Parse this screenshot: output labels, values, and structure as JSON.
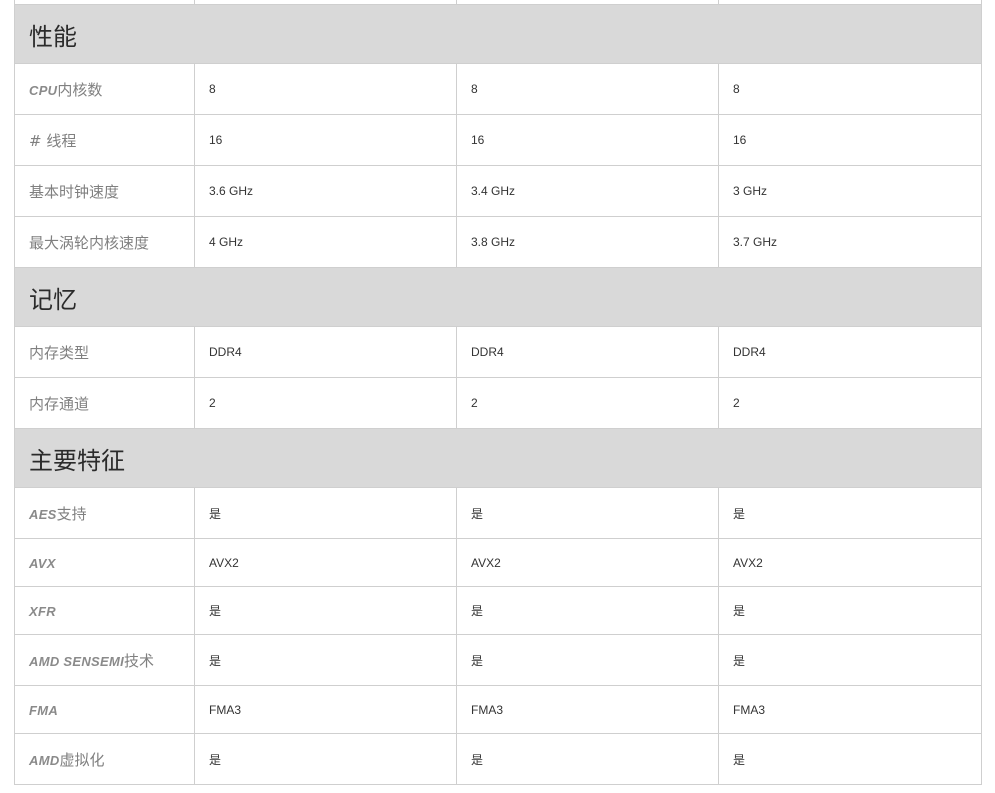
{
  "performance": {
    "title": "性能",
    "rows": [
      {
        "label_latin": "CPU",
        "label": "内核数",
        "values": [
          "8",
          "8",
          "8"
        ]
      },
      {
        "label_latin": "",
        "label": "# 线程",
        "values": [
          "16",
          "16",
          "16"
        ]
      },
      {
        "label_latin": "",
        "label": "基本时钟速度",
        "values": [
          "3.6 GHz",
          "3.4 GHz",
          "3 GHz"
        ]
      },
      {
        "label_latin": "",
        "label": "最大涡轮内核速度",
        "values": [
          "4 GHz",
          "3.8 GHz",
          "3.7 GHz"
        ]
      }
    ]
  },
  "memory": {
    "title": "记忆",
    "rows": [
      {
        "label_latin": "",
        "label": "内存类型",
        "values": [
          "DDR4",
          "DDR4",
          "DDR4"
        ]
      },
      {
        "label_latin": "",
        "label": "内存通道",
        "values": [
          "2",
          "2",
          "2"
        ]
      }
    ]
  },
  "features": {
    "title": "主要特征",
    "rows": [
      {
        "label_latin": "AES",
        "label": "支持",
        "values": [
          "是",
          "是",
          "是"
        ]
      },
      {
        "label_latin": "AVX",
        "label": "",
        "values": [
          "AVX2",
          "AVX2",
          "AVX2"
        ]
      },
      {
        "label_latin": "XFR",
        "label": "",
        "values": [
          "是",
          "是",
          "是"
        ]
      },
      {
        "label_latin": "AMD SENSEMI",
        "label": "技术",
        "values": [
          "是",
          "是",
          "是"
        ]
      },
      {
        "label_latin": "FMA",
        "label": "",
        "values": [
          "FMA3",
          "FMA3",
          "FMA3"
        ]
      },
      {
        "label_latin": "AMD",
        "label": "虚拟化",
        "values": [
          "是",
          "是",
          "是"
        ]
      }
    ]
  }
}
